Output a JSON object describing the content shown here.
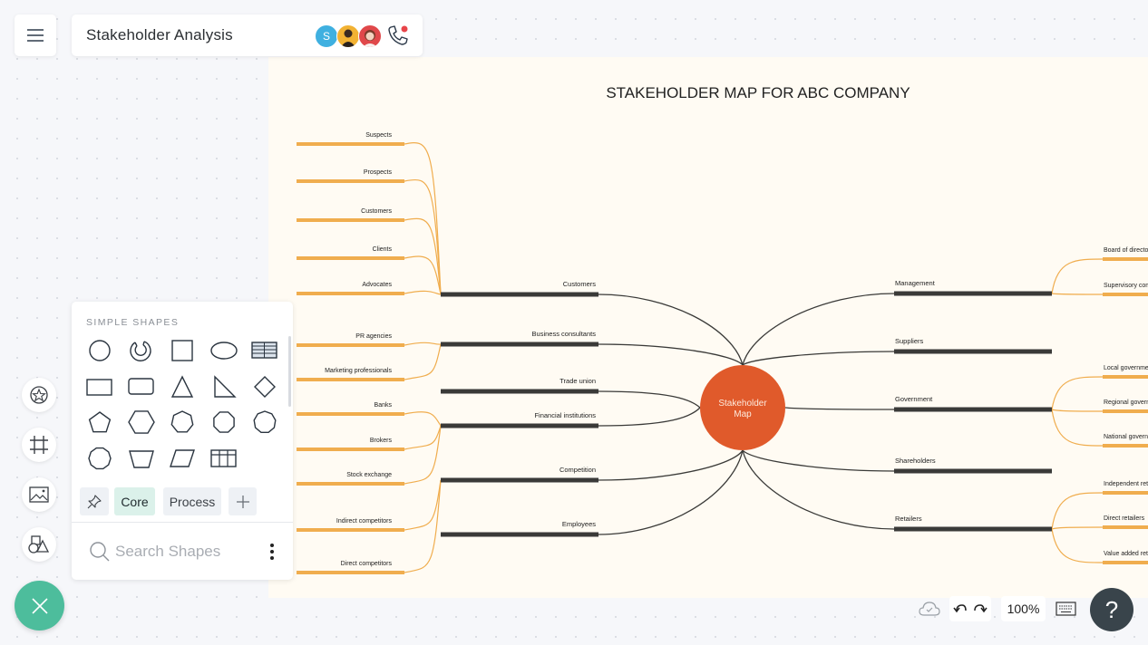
{
  "header": {
    "title": "Stakeholder Analysis",
    "collaborators": [
      {
        "initial": "S",
        "color": "#3fb0e0"
      },
      {
        "initial": "",
        "color": "#f2b233"
      },
      {
        "initial": "",
        "color": "#e0484a"
      }
    ]
  },
  "shapes_panel": {
    "heading": "SIMPLE SHAPES",
    "shapes": [
      "circle",
      "partial-ring",
      "square",
      "ellipse",
      "table-striped",
      "rectangle",
      "rounded-rectangle",
      "triangle",
      "right-triangle",
      "diamond",
      "pentagon",
      "hexagon",
      "heptagon",
      "octagon",
      "nonagon",
      "decagon",
      "trapezoid",
      "parallelogram",
      "table-grid"
    ],
    "tabs": [
      {
        "label": "Core",
        "active": true
      },
      {
        "label": "Process",
        "active": false
      }
    ],
    "search_placeholder": "Search Shapes"
  },
  "diagram": {
    "title": "STAKEHOLDER MAP FOR ABC COMPANY",
    "center_label": [
      "Stakeholder",
      "Map"
    ],
    "colors": {
      "center": "#e05a2b",
      "branch": "#3a3a38",
      "leaf": "#f0ad4e",
      "background": "#fffbf3"
    },
    "left_branches": [
      {
        "label": "Customers",
        "leaves": [
          "Suspects",
          "Prospects",
          "Customers",
          "Clients",
          "Advocates"
        ]
      },
      {
        "label": "Business consultants",
        "leaves": [
          "PR agencies",
          "Marketing professionals"
        ]
      },
      {
        "label": "Trade union",
        "leaves": []
      },
      {
        "label": "Financial institutions",
        "leaves": [
          "Banks",
          "Brokers",
          "Stock exchange"
        ]
      },
      {
        "label": "Competition",
        "leaves": [
          "Indirect competitors",
          "Direct competitors"
        ]
      },
      {
        "label": "Employees",
        "leaves": []
      }
    ],
    "right_branches": [
      {
        "label": "Management",
        "leaves": [
          "Board of directors",
          "Supervisory committee"
        ]
      },
      {
        "label": "Suppliers",
        "leaves": []
      },
      {
        "label": "Government",
        "leaves": [
          "Local government",
          "Regional government",
          "National government"
        ]
      },
      {
        "label": "Shareholders",
        "leaves": []
      },
      {
        "label": "Retailers",
        "leaves": [
          "Independent retailers",
          "Direct retailers",
          "Value added retailers"
        ]
      }
    ]
  },
  "footer": {
    "zoom_level": "100%",
    "help_label": "?"
  }
}
